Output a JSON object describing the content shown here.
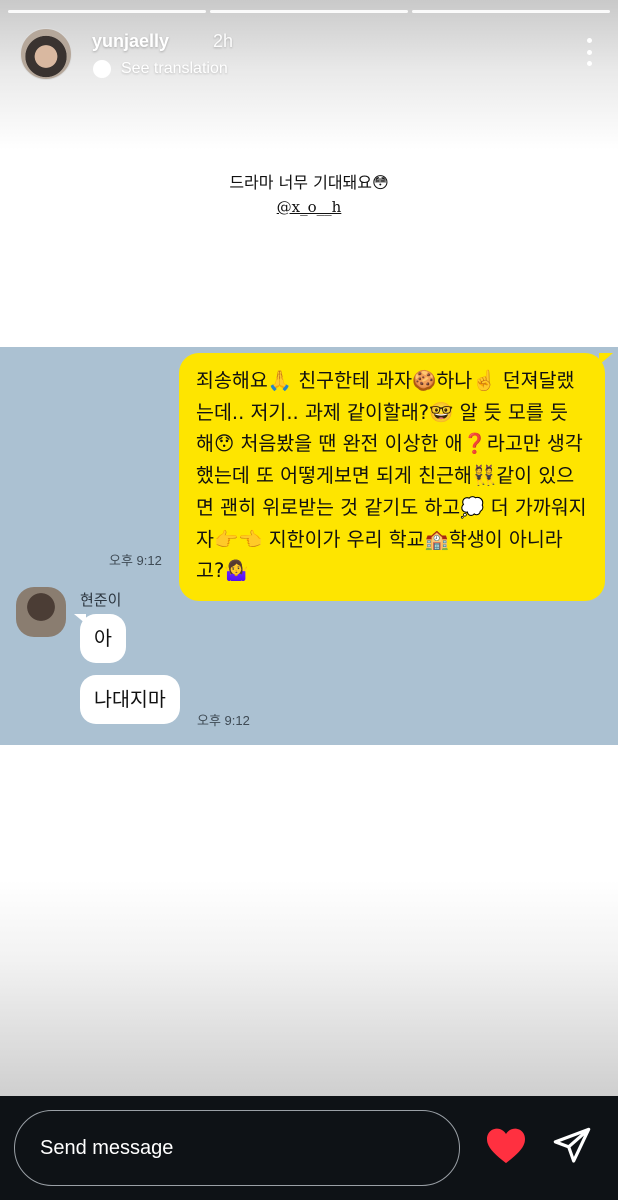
{
  "header": {
    "username": "yunjaelly",
    "time": "2h",
    "see_translation": "See translation"
  },
  "caption": {
    "line1": "드라마 너무 기대돼요😳",
    "mention": "@x_o__h"
  },
  "chat": {
    "my_message": "죄송해요🙏 친구한테 과자🍪하나☝️ 던져달랬는데.. 저기.. 과제 같이할래?🤓 알 듯 모를 듯 해😯 처음봤을 땐 완전 이상한 애❓라고만 생각했는데 또 어떻게보면 되게 친근해👯같이 있으면 괜히 위로받는 것 같기도 하고💭 더 가까워지자👉👈 지한이가 우리 학교🏫학생이 아니라고?🤷‍♀️",
    "my_time": "오후 9:12",
    "friend_name": "현준이",
    "friend_msg1": "아",
    "friend_msg2": "나대지마",
    "friend_time": "오후 9:12"
  },
  "footer": {
    "message_placeholder": "Send message"
  },
  "colors": {
    "my_bubble": "#fee500",
    "chat_bg": "#abc1d2",
    "heart": "#ff3040"
  }
}
